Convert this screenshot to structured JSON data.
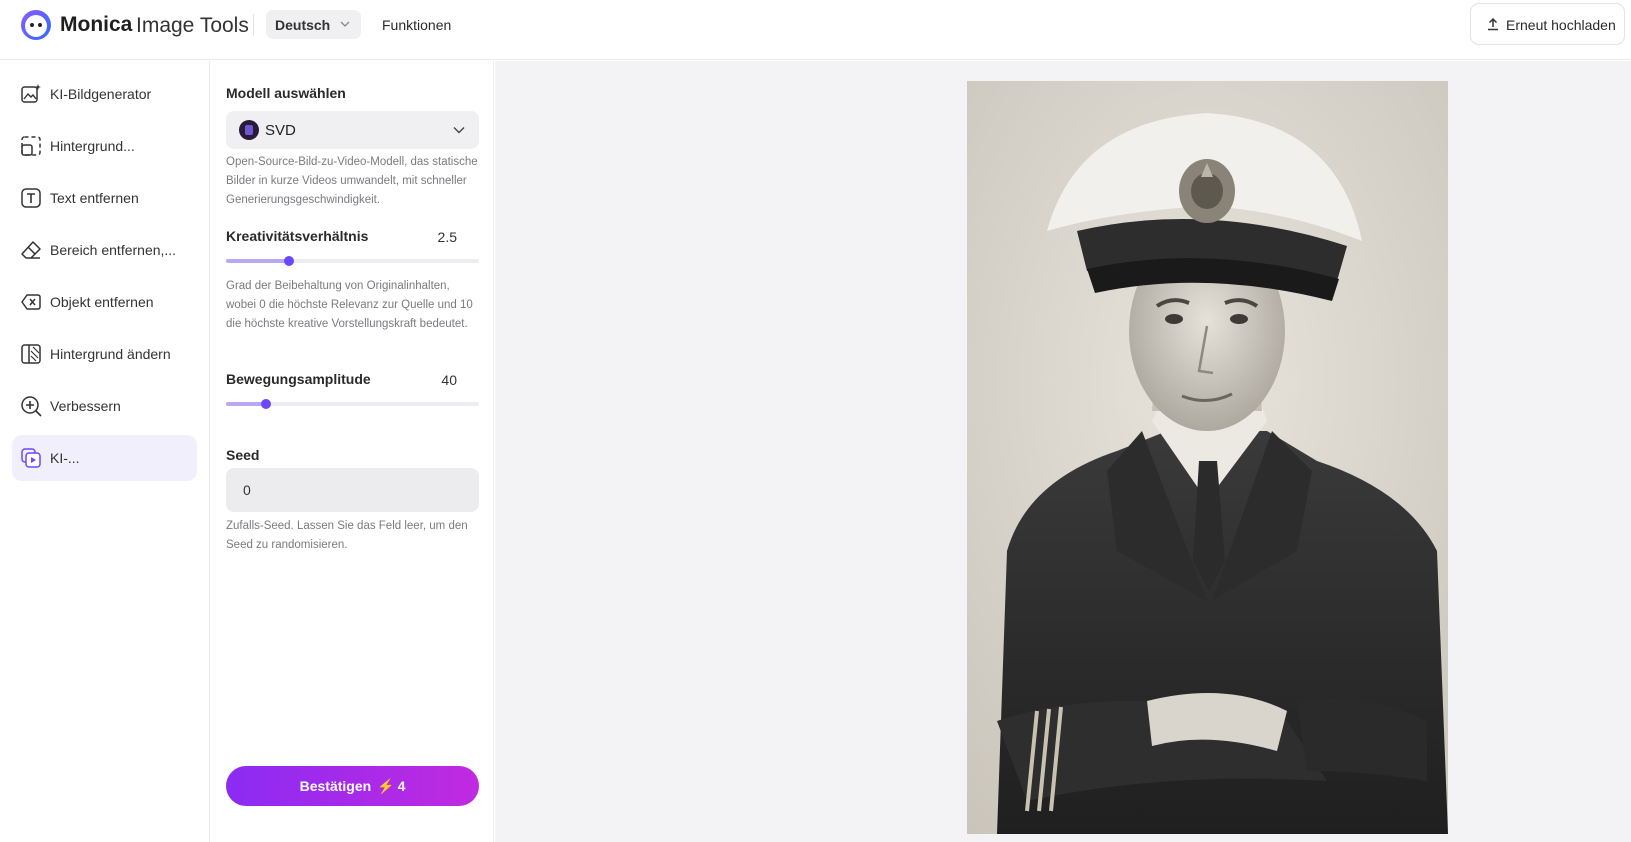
{
  "header": {
    "brand": "Monica",
    "brand_sub": "Image Tools",
    "language": "Deutsch",
    "nav_functions": "Funktionen",
    "reupload_label": "Erneut hochladen"
  },
  "sidebar": {
    "items": [
      {
        "label": "KI-Bildgenerator",
        "icon": "image-sparkle-icon"
      },
      {
        "label": "Hintergrund...",
        "icon": "background-remove-icon"
      },
      {
        "label": "Text entfernen",
        "icon": "text-remove-icon"
      },
      {
        "label": "Bereich entfernen,...",
        "icon": "eraser-icon"
      },
      {
        "label": "Objekt entfernen",
        "icon": "object-remove-icon"
      },
      {
        "label": "Hintergrund ändern",
        "icon": "background-change-icon"
      },
      {
        "label": "Verbessern",
        "icon": "enhance-icon"
      },
      {
        "label": "KI-...",
        "icon": "ai-video-icon",
        "active": true
      }
    ]
  },
  "panel": {
    "model_label": "Modell auswählen",
    "model_value": "SVD",
    "model_desc": "Open-Source-Bild-zu-Video-Modell, das statische Bilder in kurze Videos umwandelt, mit schneller Generierungsgeschwindigkeit.",
    "creativity_label": "Kreativitätsverhältnis",
    "creativity_value": "2.5",
    "creativity_level": 0.25,
    "creativity_desc": "Grad der Beibehaltung von Originalinhalten, wobei 0 die höchste Relevanz zur Quelle und 10 die höchste kreative Vorstellungskraft bedeutet.",
    "motion_label": "Bewegungsamplitude",
    "motion_value": "40",
    "motion_level": 0.16,
    "seed_label": "Seed",
    "seed_value": "0",
    "seed_desc": "Zufalls-Seed. Lassen Sie das Feld leer, um den Seed zu randomisieren.",
    "confirm_label": "Bestätigen",
    "confirm_cost": "4"
  },
  "colors": {
    "accent": "#6c47ff",
    "slider_fill": "#b9a8f2",
    "button_gradient_start": "#8b2bf3",
    "button_gradient_end": "#c12ae0",
    "active_item_bg": "#f1effc"
  }
}
